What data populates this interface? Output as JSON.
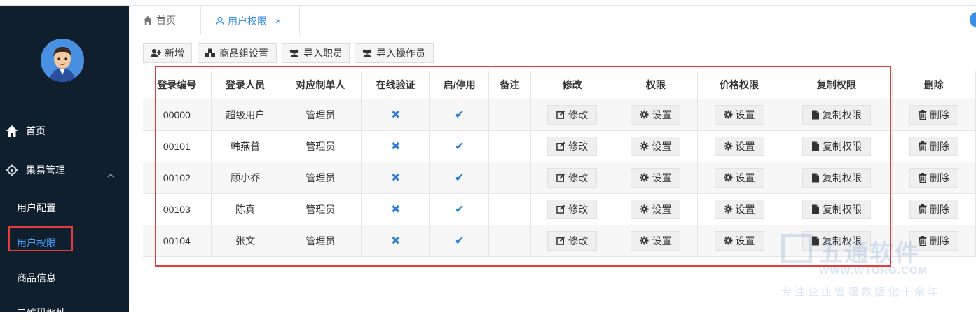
{
  "sidebar": {
    "menu": [
      {
        "label": "首页",
        "icon": "home-icon"
      },
      {
        "label": "果易管理",
        "icon": "gear-icon"
      }
    ],
    "sub_items": [
      {
        "label": "用户配置"
      },
      {
        "label": "用户权限",
        "active": true
      },
      {
        "label": "商品信息"
      },
      {
        "label": "二维码地址"
      }
    ]
  },
  "tabs": {
    "home_label": "首页",
    "active_label": "用户权限",
    "close_symbol": "×"
  },
  "toolbar": {
    "add_label": "新增",
    "group_label": "商品组设置",
    "import_staff_label": "导入职员",
    "import_operator_label": "导入操作员"
  },
  "table": {
    "headers": [
      "登录编号",
      "登录人员",
      "对应制单人",
      "在线验证",
      "启/停用",
      "备注",
      "修改",
      "权限",
      "价格权限",
      "复制权限",
      "删除"
    ],
    "rows": [
      {
        "id": "00000",
        "name": "超级用户",
        "maker": "管理员",
        "online": false,
        "enabled": true,
        "note": ""
      },
      {
        "id": "00101",
        "name": "韩燕普",
        "maker": "管理员",
        "online": false,
        "enabled": true,
        "note": ""
      },
      {
        "id": "00102",
        "name": "顾小乔",
        "maker": "管理员",
        "online": false,
        "enabled": true,
        "note": ""
      },
      {
        "id": "00103",
        "name": "陈真",
        "maker": "管理员",
        "online": false,
        "enabled": true,
        "note": ""
      },
      {
        "id": "00104",
        "name": "张文",
        "maker": "管理员",
        "online": false,
        "enabled": true,
        "note": ""
      }
    ],
    "edit_label": "修改",
    "set_label": "设置",
    "copy_label": "复制权限",
    "delete_label": "删除"
  },
  "watermark": {
    "title": "五通软件",
    "url": "WWW.WTORG.COM",
    "slogan": "专注企业管理数据化十余年"
  },
  "colors": {
    "sidebar_bg": "#0f1f2d",
    "accent": "#3a8ee6",
    "highlight": "#e23c3c"
  }
}
